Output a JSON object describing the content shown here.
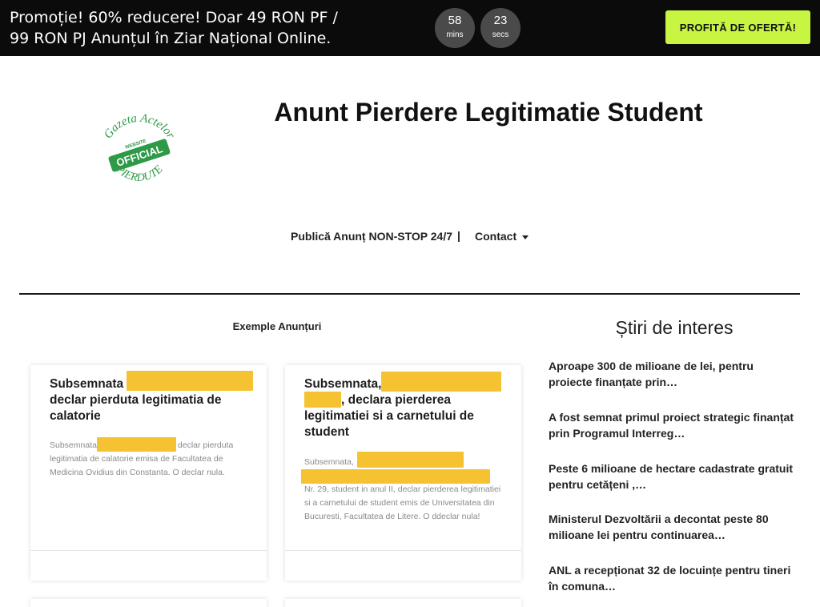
{
  "promo": {
    "text": "Promoție! 60% reducere! Doar 49 RON PF / 99 RON PJ Anunțul în Ziar Național Online.",
    "timer_minutes": "58",
    "timer_minutes_unit": "mins",
    "timer_seconds": "23",
    "timer_seconds_unit": "secs",
    "cta_label": "PROFITĂ DE OFERTĂ!",
    "cta_color": "#c8f542"
  },
  "logo": {
    "line1": "Gazeta Actelor",
    "badge_top": "WEBSITE",
    "badge": "OFFICIAL",
    "line2": "PIERDUTE",
    "color": "#2e9a48"
  },
  "page_title": "Anunt Pierdere Legitimatie Student",
  "nav": {
    "publish": "Publică Anunț NON-STOP 24/7",
    "separator": "|",
    "contact": "Contact"
  },
  "examples_heading": "Exemple Anunțuri",
  "cards": [
    {
      "title_line1": "Subsemnata",
      "title_rest": "declar pierduta legitimatia de calatorie",
      "excerpt_lead": "Subsemnata",
      "excerpt_tail": " declar pierduta",
      "excerpt_rest": "legitimatia de calatorie emisa de Facultatea de Medicina Ovidius din Constanta. O declar nula."
    },
    {
      "title_line1": "Subsemnata,",
      "title_line2_tail": ", declara pierderea",
      "title_rest": "legitimatiei si a carnetului de student",
      "excerpt_lead": "Subsemnata,",
      "excerpt_rest": "Nr. 29, student in anul II, declar pierderea legitimatiei si a carnetului de student emis de Universitatea din Bucuresti, Facultatea de Litere. O ddeclar nula!"
    }
  ],
  "redaction_color": "#f5c232",
  "news": {
    "heading": "Știri de interes",
    "items": [
      "Aproape 300 de milioane de lei, pentru proiecte finanțate prin…",
      "A fost semnat primul proiect strategic finanțat prin Programul Interreg…",
      "Peste 6 milioane de hectare cadastrate gratuit pentru cetățeni ,…",
      "Ministerul Dezvoltării a decontat peste 80 milioane lei pentru continuarea…",
      "ANL a recepționat 32 de locuințe pentru tineri în comuna…"
    ]
  }
}
